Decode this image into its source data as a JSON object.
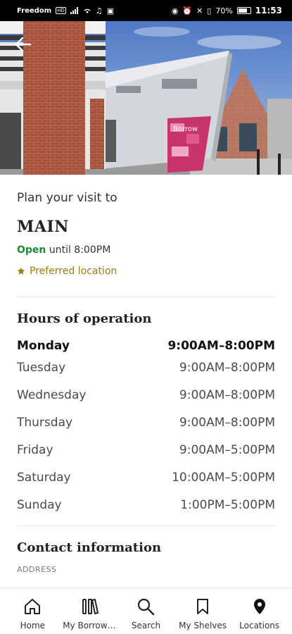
{
  "status_bar": {
    "carrier": "Freedom",
    "network_badge": "HD",
    "battery_text": "70%",
    "time": "11:53"
  },
  "hero": {
    "sign_text": "Borrow"
  },
  "header": {
    "plan_label": "Plan your visit to",
    "branch_name": "MAIN",
    "open_status": "Open",
    "open_until": "until 8:00PM",
    "preferred_label": "Preferred location"
  },
  "hours_section": {
    "title": "Hours of operation",
    "rows": [
      {
        "day": "Monday",
        "hours": "9:00AM–8:00PM"
      },
      {
        "day": "Tuesday",
        "hours": "9:00AM–8:00PM"
      },
      {
        "day": "Wednesday",
        "hours": "9:00AM–8:00PM"
      },
      {
        "day": "Thursday",
        "hours": "9:00AM–8:00PM"
      },
      {
        "day": "Friday",
        "hours": "9:00AM–5:00PM"
      },
      {
        "day": "Saturday",
        "hours": "10:00AM–5:00PM"
      },
      {
        "day": "Sunday",
        "hours": "1:00PM–5:00PM"
      }
    ]
  },
  "contact_section": {
    "title": "Contact information",
    "address_label": "ADDRESS"
  },
  "bottom_nav": {
    "items": [
      {
        "label": "Home",
        "icon": "home-icon"
      },
      {
        "label": "My Borrow…",
        "icon": "books-icon"
      },
      {
        "label": "Search",
        "icon": "search-icon"
      },
      {
        "label": "My Shelves",
        "icon": "bookmark-icon"
      },
      {
        "label": "Locations",
        "icon": "location-pin-icon"
      }
    ]
  },
  "colors": {
    "open_green": "#1c8c37",
    "preferred_gold": "#9c7b10"
  }
}
